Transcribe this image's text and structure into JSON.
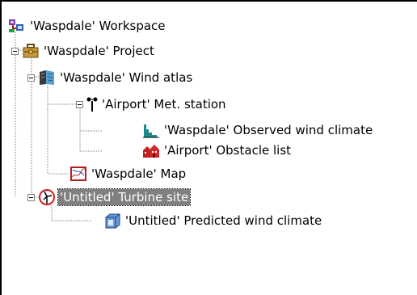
{
  "tree": {
    "workspace": {
      "label": "'Waspdale' Workspace",
      "icon": "workspace-icon"
    },
    "project": {
      "label": "'Waspdale' Project",
      "icon": "briefcase-icon"
    },
    "wind_atlas": {
      "label": "'Waspdale' Wind atlas",
      "icon": "book-icon"
    },
    "met_station": {
      "label": "'Airport' Met. station",
      "icon": "anemometer-icon"
    },
    "observed_climate": {
      "label": "'Waspdale' Observed wind climate",
      "icon": "histogram-icon"
    },
    "obstacle_list": {
      "label": "'Airport' Obstacle list",
      "icon": "buildings-icon"
    },
    "map": {
      "label": "'Waspdale' Map",
      "icon": "map-icon"
    },
    "turbine_site": {
      "label": "'Untitled' Turbine site",
      "icon": "turbine-icon",
      "selected": true
    },
    "predicted_climate": {
      "label": "'Untitled' Predicted wind climate",
      "icon": "predicted-climate-icon"
    }
  },
  "colors": {
    "selection_bg": "#808080",
    "selection_text": "#ffffff",
    "tree_line": "#808080"
  }
}
